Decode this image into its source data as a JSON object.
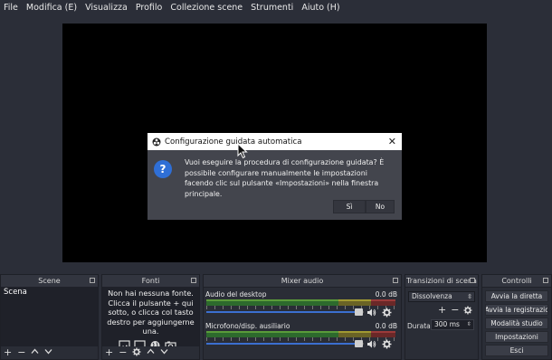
{
  "menu": [
    "File",
    "Modifica (E)",
    "Visualizza",
    "Profilo",
    "Collezione scene",
    "Strumenti",
    "Aiuto (H)"
  ],
  "docks": {
    "scenes": {
      "title": "Scene",
      "items": [
        "Scena"
      ]
    },
    "sources": {
      "title": "Fonti",
      "empty_text": "Non hai nessuna fonte. Clicca il pulsante + qui sotto, o clicca col tasto destro per aggiungerne una."
    },
    "mixer": {
      "title": "Mixer audio",
      "channels": [
        {
          "name": "Audio del desktop",
          "db": "0.0 dB",
          "volume": 1.0
        },
        {
          "name": "Microfono/disp. ausiliario",
          "db": "0.0 dB",
          "volume": 1.0
        }
      ]
    },
    "transitions": {
      "title": "Transizioni di scena",
      "selected": "Dissolvenza",
      "duration_label": "Durata",
      "duration_value": "300 ms"
    },
    "controls": {
      "title": "Controlli",
      "buttons": [
        "Avvia la diretta",
        "Avvia la registrazic",
        "Modalità studio",
        "Impostazioni",
        "Esci"
      ]
    }
  },
  "dialog": {
    "title": "Configurazione guidata automatica",
    "message": "Vuoi eseguire la procedura di configurazione guidata? È possibile configurare manualmente le impostazioni facendo clic sul pulsante «Impostazioni» nella finestra principale.",
    "yes_label": "Sì",
    "no_label": "No"
  },
  "colors": {
    "background": "#2b2e38",
    "preview": "#000000",
    "accent": "#2f6fd6"
  }
}
